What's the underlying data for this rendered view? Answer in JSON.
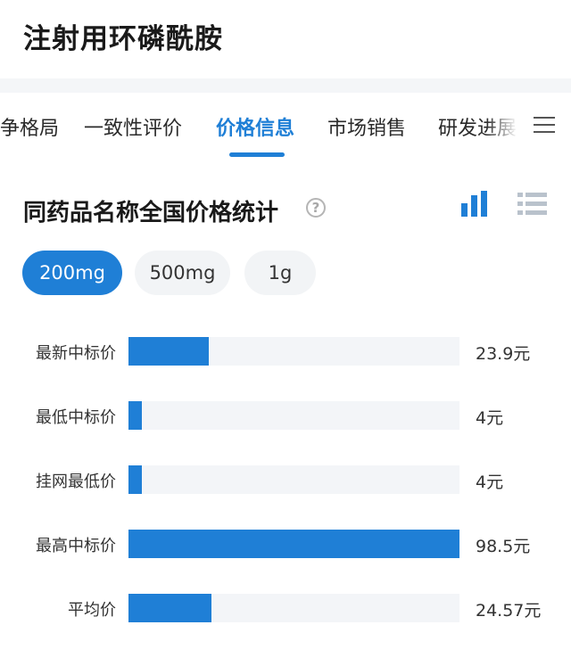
{
  "page": {
    "title": "注射用环磷酰胺"
  },
  "tabs": [
    {
      "label": "竞争格局",
      "active": false
    },
    {
      "label": "一致性评价",
      "active": false
    },
    {
      "label": "价格信息",
      "active": true
    },
    {
      "label": "市场销售",
      "active": false
    },
    {
      "label": "研发进展",
      "active": false
    }
  ],
  "section": {
    "title": "同药品名称全国价格统计",
    "help_icon": "question-circle-icon",
    "view_icons": [
      "bar-chart-icon",
      "list-view-icon"
    ]
  },
  "specs": [
    {
      "label": "200mg",
      "active": true
    },
    {
      "label": "500mg",
      "active": false
    },
    {
      "label": "1g",
      "active": false
    }
  ],
  "colors": {
    "accent": "#1f7fd6",
    "track": "#f3f5f8"
  },
  "chart_data": {
    "type": "bar",
    "orientation": "horizontal",
    "categories": [
      "最新中标价",
      "最低中标价",
      "挂网最低价",
      "最高中标价",
      "平均价"
    ],
    "values": [
      23.9,
      4,
      4,
      98.5,
      24.57
    ],
    "value_labels": [
      "23.9元",
      "4元",
      "4元",
      "98.5元",
      "24.57元"
    ],
    "xlim": [
      0,
      98.5
    ]
  }
}
